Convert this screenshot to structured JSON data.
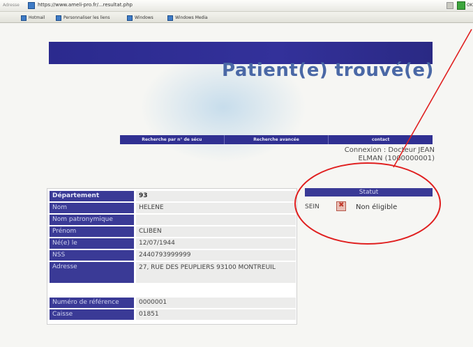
{
  "browser": {
    "address_label": "Adresse",
    "url": "https://www.ameli-pro.fr/...resultat.php",
    "go_label": "OK",
    "links": [
      {
        "label": "Hotmail"
      },
      {
        "label": "Personnaliser les liens"
      },
      {
        "label": "Windows"
      },
      {
        "label": "Windows Media"
      }
    ]
  },
  "page": {
    "title": "Patient(e) trouvé(e)",
    "nav": [
      {
        "label": "Recherche par n° de sécu"
      },
      {
        "label": "Recherche avancée"
      },
      {
        "label": "contact"
      }
    ],
    "connexion_line1": "Connexion : Docteur JEAN",
    "connexion_line2": "ELMAN (1000000001)"
  },
  "patient": {
    "rows": [
      {
        "label": "Département",
        "value": "93"
      },
      {
        "label": "Nom",
        "value": "HELENE"
      },
      {
        "label": "Nom patronymique",
        "value": ""
      },
      {
        "label": "Prénom",
        "value": "CLIBEN"
      },
      {
        "label": "Né(e) le",
        "value": "12/07/1944"
      },
      {
        "label": "NSS",
        "value": "2440793999999"
      },
      {
        "label": "Adresse",
        "value": "27, RUE DES PEUPLIERS 93100 MONTREUIL"
      },
      {
        "label": "Numéro de référence",
        "value": "0000001"
      },
      {
        "label": "Caisse",
        "value": "01851"
      }
    ]
  },
  "statut": {
    "header": "Statut",
    "type": "SEIN",
    "value": "Non éligible",
    "icon": "cross-icon",
    "status_color": "#c0392b"
  },
  "annotation": {
    "color": "#e02020"
  }
}
